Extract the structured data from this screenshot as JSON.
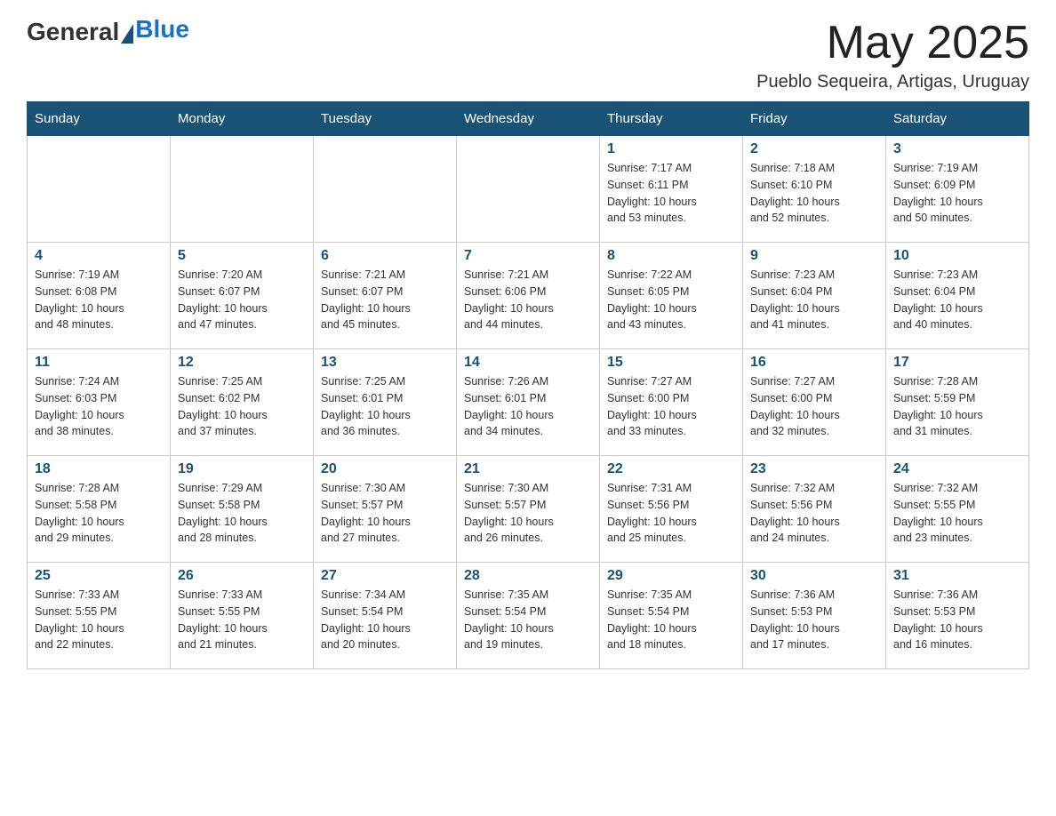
{
  "header": {
    "logo": {
      "general": "General",
      "blue": "Blue"
    },
    "title": "May 2025",
    "subtitle": "Pueblo Sequeira, Artigas, Uruguay"
  },
  "days_of_week": [
    "Sunday",
    "Monday",
    "Tuesday",
    "Wednesday",
    "Thursday",
    "Friday",
    "Saturday"
  ],
  "weeks": [
    [
      {
        "day": "",
        "info": ""
      },
      {
        "day": "",
        "info": ""
      },
      {
        "day": "",
        "info": ""
      },
      {
        "day": "",
        "info": ""
      },
      {
        "day": "1",
        "info": "Sunrise: 7:17 AM\nSunset: 6:11 PM\nDaylight: 10 hours\nand 53 minutes."
      },
      {
        "day": "2",
        "info": "Sunrise: 7:18 AM\nSunset: 6:10 PM\nDaylight: 10 hours\nand 52 minutes."
      },
      {
        "day": "3",
        "info": "Sunrise: 7:19 AM\nSunset: 6:09 PM\nDaylight: 10 hours\nand 50 minutes."
      }
    ],
    [
      {
        "day": "4",
        "info": "Sunrise: 7:19 AM\nSunset: 6:08 PM\nDaylight: 10 hours\nand 48 minutes."
      },
      {
        "day": "5",
        "info": "Sunrise: 7:20 AM\nSunset: 6:07 PM\nDaylight: 10 hours\nand 47 minutes."
      },
      {
        "day": "6",
        "info": "Sunrise: 7:21 AM\nSunset: 6:07 PM\nDaylight: 10 hours\nand 45 minutes."
      },
      {
        "day": "7",
        "info": "Sunrise: 7:21 AM\nSunset: 6:06 PM\nDaylight: 10 hours\nand 44 minutes."
      },
      {
        "day": "8",
        "info": "Sunrise: 7:22 AM\nSunset: 6:05 PM\nDaylight: 10 hours\nand 43 minutes."
      },
      {
        "day": "9",
        "info": "Sunrise: 7:23 AM\nSunset: 6:04 PM\nDaylight: 10 hours\nand 41 minutes."
      },
      {
        "day": "10",
        "info": "Sunrise: 7:23 AM\nSunset: 6:04 PM\nDaylight: 10 hours\nand 40 minutes."
      }
    ],
    [
      {
        "day": "11",
        "info": "Sunrise: 7:24 AM\nSunset: 6:03 PM\nDaylight: 10 hours\nand 38 minutes."
      },
      {
        "day": "12",
        "info": "Sunrise: 7:25 AM\nSunset: 6:02 PM\nDaylight: 10 hours\nand 37 minutes."
      },
      {
        "day": "13",
        "info": "Sunrise: 7:25 AM\nSunset: 6:01 PM\nDaylight: 10 hours\nand 36 minutes."
      },
      {
        "day": "14",
        "info": "Sunrise: 7:26 AM\nSunset: 6:01 PM\nDaylight: 10 hours\nand 34 minutes."
      },
      {
        "day": "15",
        "info": "Sunrise: 7:27 AM\nSunset: 6:00 PM\nDaylight: 10 hours\nand 33 minutes."
      },
      {
        "day": "16",
        "info": "Sunrise: 7:27 AM\nSunset: 6:00 PM\nDaylight: 10 hours\nand 32 minutes."
      },
      {
        "day": "17",
        "info": "Sunrise: 7:28 AM\nSunset: 5:59 PM\nDaylight: 10 hours\nand 31 minutes."
      }
    ],
    [
      {
        "day": "18",
        "info": "Sunrise: 7:28 AM\nSunset: 5:58 PM\nDaylight: 10 hours\nand 29 minutes."
      },
      {
        "day": "19",
        "info": "Sunrise: 7:29 AM\nSunset: 5:58 PM\nDaylight: 10 hours\nand 28 minutes."
      },
      {
        "day": "20",
        "info": "Sunrise: 7:30 AM\nSunset: 5:57 PM\nDaylight: 10 hours\nand 27 minutes."
      },
      {
        "day": "21",
        "info": "Sunrise: 7:30 AM\nSunset: 5:57 PM\nDaylight: 10 hours\nand 26 minutes."
      },
      {
        "day": "22",
        "info": "Sunrise: 7:31 AM\nSunset: 5:56 PM\nDaylight: 10 hours\nand 25 minutes."
      },
      {
        "day": "23",
        "info": "Sunrise: 7:32 AM\nSunset: 5:56 PM\nDaylight: 10 hours\nand 24 minutes."
      },
      {
        "day": "24",
        "info": "Sunrise: 7:32 AM\nSunset: 5:55 PM\nDaylight: 10 hours\nand 23 minutes."
      }
    ],
    [
      {
        "day": "25",
        "info": "Sunrise: 7:33 AM\nSunset: 5:55 PM\nDaylight: 10 hours\nand 22 minutes."
      },
      {
        "day": "26",
        "info": "Sunrise: 7:33 AM\nSunset: 5:55 PM\nDaylight: 10 hours\nand 21 minutes."
      },
      {
        "day": "27",
        "info": "Sunrise: 7:34 AM\nSunset: 5:54 PM\nDaylight: 10 hours\nand 20 minutes."
      },
      {
        "day": "28",
        "info": "Sunrise: 7:35 AM\nSunset: 5:54 PM\nDaylight: 10 hours\nand 19 minutes."
      },
      {
        "day": "29",
        "info": "Sunrise: 7:35 AM\nSunset: 5:54 PM\nDaylight: 10 hours\nand 18 minutes."
      },
      {
        "day": "30",
        "info": "Sunrise: 7:36 AM\nSunset: 5:53 PM\nDaylight: 10 hours\nand 17 minutes."
      },
      {
        "day": "31",
        "info": "Sunrise: 7:36 AM\nSunset: 5:53 PM\nDaylight: 10 hours\nand 16 minutes."
      }
    ]
  ]
}
